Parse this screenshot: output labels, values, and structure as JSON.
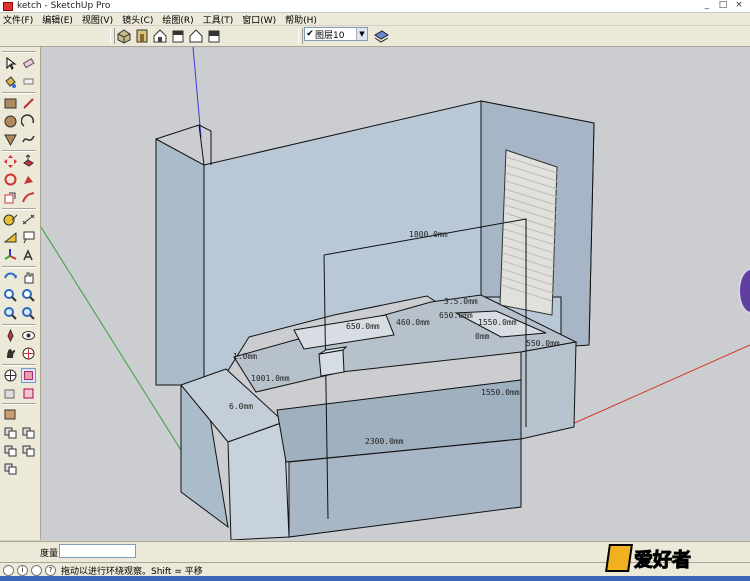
{
  "window": {
    "title": "ketch - SketchUp Pro",
    "controls": [
      "_",
      "□",
      "×"
    ]
  },
  "menubar": {
    "items": [
      "文件(F)",
      "编辑(E)",
      "视图(V)",
      "镜头(C)",
      "绘图(R)",
      "工具(T)",
      "窗口(W)",
      "帮助(H)"
    ]
  },
  "toolbar": {
    "views": [
      "iso-view-icon",
      "top-view-icon",
      "front-view-icon",
      "right-view-icon",
      "back-view-icon",
      "left-view-icon"
    ],
    "layer": {
      "checked": "✔",
      "value": "图层10"
    }
  },
  "palette": {
    "tools": [
      "select-icon",
      "eraser-icon",
      "paint-bucket-icon",
      "eraser-alt-icon",
      "rectangle-icon",
      "line-icon",
      "circle-icon",
      "arc-icon",
      "polygon-icon",
      "freehand-icon",
      "move-icon",
      "push-pull-icon",
      "rotate-icon",
      "follow-me-icon",
      "scale-icon",
      "offset-icon",
      "tape-measure-icon",
      "dimension-icon",
      "protractor-icon",
      "text-icon",
      "axes-icon",
      "3d-text-icon",
      "orbit-icon",
      "pan-icon",
      "zoom-icon",
      "zoom-window-icon",
      "previous-icon",
      "zoom-extents-icon",
      "position-camera-icon",
      "walk-icon",
      "look-around-icon",
      "section-plane-icon",
      "sandbox-icon",
      "component-icon",
      "layer-icon",
      "style-icon",
      "shadow-icon",
      "fog-icon",
      "match-photo-icon",
      "outliner-icon"
    ]
  },
  "dimensions": {
    "d1": "1800.0mm",
    "d2": "650.0mm",
    "d3": "460.0mm",
    "d4": "650.0mm",
    "d5": "1550.0mm",
    "d6": "1.0mm",
    "d7": "1001.0mm",
    "d8": "550.0mm",
    "d9": "2300.0mm",
    "d10": "1550.0mm",
    "d11": "0mm",
    "d12": "6.0mm",
    "d13": "3.5.0mm"
  },
  "measure": {
    "label": "度量",
    "value": ""
  },
  "status": {
    "text": "拖动以进行环绕观察。Shift = 平移"
  },
  "colors": {
    "axis_red": "#d23a2a",
    "axis_green": "#3aa03a",
    "axis_blue": "#3a3ad2",
    "face": "#b9c8d6"
  }
}
